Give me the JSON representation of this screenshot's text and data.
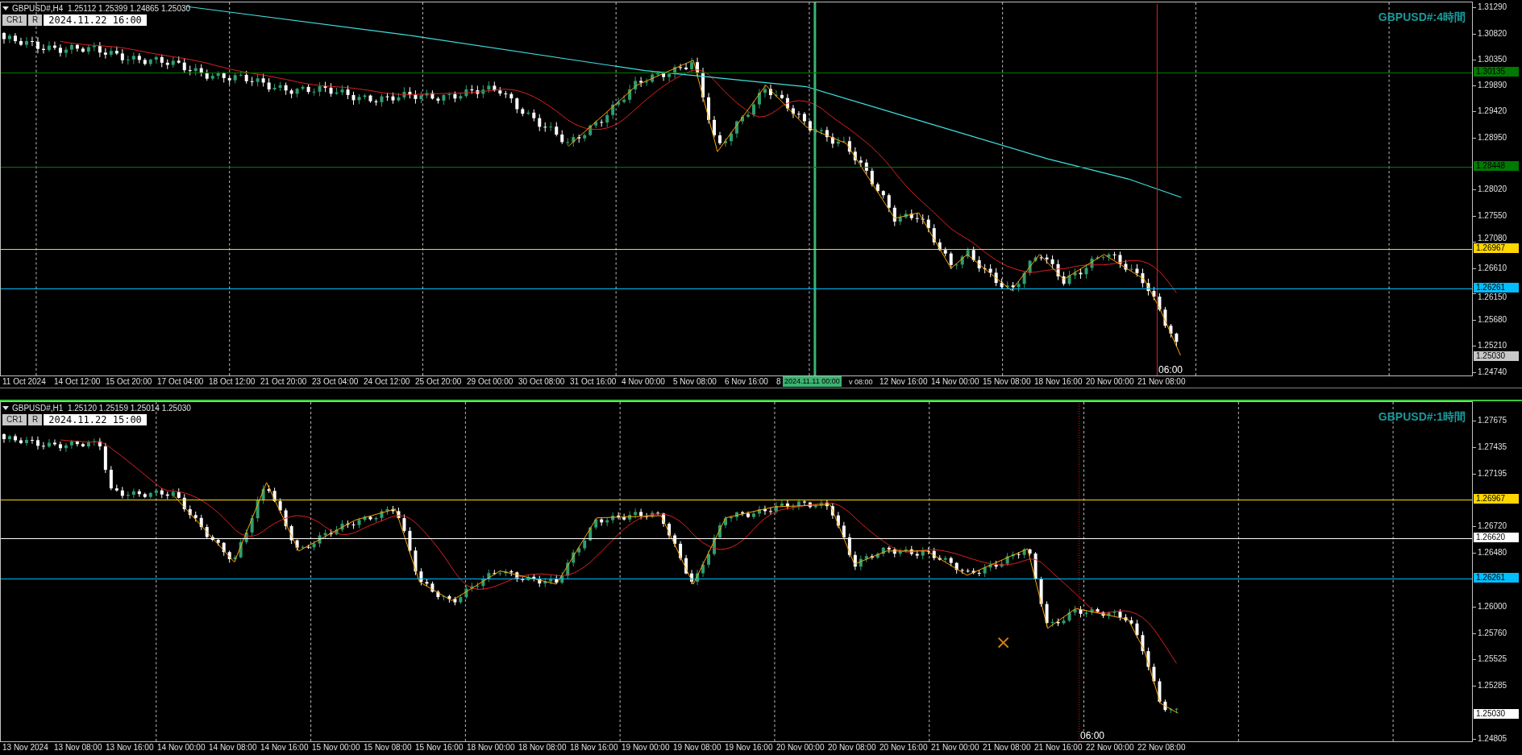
{
  "charts": [
    {
      "symbol_line": "GBPUSD#,H4  1.25112 1.25399 1.24865 1.25030",
      "buttons": [
        "CR1",
        "R"
      ],
      "date_field": "2024.11.22 16:00",
      "title": "GBPUSD#:4時間",
      "active": false,
      "price_axis": [
        "1.31290",
        "1.30820",
        "1.30350",
        "1.29890",
        "1.29420",
        "1.28950",
        "1.28020",
        "1.27550",
        "1.27080",
        "1.26610",
        "1.26150",
        "1.25680",
        "1.25210",
        "1.24740"
      ],
      "levels": [
        {
          "price": "1.30135",
          "color": "#007a00"
        },
        {
          "price": "1.28448",
          "color": "#007a00"
        },
        {
          "price": "1.26967",
          "color": "#ffd700"
        },
        {
          "price": "1.26261",
          "color": "#00bfff"
        }
      ],
      "current_price": {
        "price": "1.25030",
        "color": "#c8c8c8"
      },
      "vline_label": "06:00",
      "time_axis": [
        {
          "kind": "tick",
          "label": "11 Oct 2024"
        },
        {
          "kind": "tick",
          "label": "14 Oct 12:00"
        },
        {
          "kind": "tick",
          "label": "15 Oct 20:00"
        },
        {
          "kind": "tick",
          "label": "17 Oct 04:00"
        },
        {
          "kind": "tick",
          "label": "18 Oct 12:00"
        },
        {
          "kind": "tick",
          "label": "21 Oct 20:00"
        },
        {
          "kind": "tick",
          "label": "23 Oct 04:00"
        },
        {
          "kind": "tick",
          "label": "24 Oct 12:00"
        },
        {
          "kind": "tick",
          "label": "25 Oct 20:00"
        },
        {
          "kind": "tick",
          "label": "29 Oct 00:00"
        },
        {
          "kind": "tick",
          "label": "30 Oct 08:00"
        },
        {
          "kind": "tick",
          "label": "31 Oct 16:00"
        },
        {
          "kind": "tick",
          "label": "4 Nov 00:00"
        },
        {
          "kind": "tick",
          "label": "5 Nov 08:00"
        },
        {
          "kind": "tick",
          "label": "6 Nov 16:00"
        },
        {
          "kind": "tick",
          "label": "8"
        },
        {
          "kind": "crosshair",
          "label": "2024.11.11 00:00"
        },
        {
          "kind": "cut",
          "label": "v 08:00"
        },
        {
          "kind": "tick",
          "label": "12 Nov 16:00"
        },
        {
          "kind": "tick",
          "label": "14 Nov 00:00"
        },
        {
          "kind": "tick",
          "label": "15 Nov 08:00"
        },
        {
          "kind": "tick",
          "label": "18 Nov 16:00"
        },
        {
          "kind": "tick",
          "label": "20 Nov 00:00"
        },
        {
          "kind": "tick",
          "label": "21 Nov 08:00"
        }
      ]
    },
    {
      "symbol_line": "GBPUSD#,H1  1.25120 1.25159 1.25014 1.25030",
      "buttons": [
        "CR1",
        "R"
      ],
      "date_field": "2024.11.22 15:00",
      "title": "GBPUSD#:1時間",
      "active": true,
      "price_axis": [
        "1.27675",
        "1.27435",
        "1.27195",
        "1.26720",
        "1.26480",
        "1.26000",
        "1.25760",
        "1.25525",
        "1.25285",
        "1.24805"
      ],
      "levels": [
        {
          "price": "1.26967",
          "color": "#ffd700"
        },
        {
          "price": "1.26620",
          "color": "#ffffff"
        },
        {
          "price": "1.26261",
          "color": "#00bfff"
        }
      ],
      "current_price": {
        "price": "1.25030",
        "color": "#ffffff"
      },
      "vline_label": "06:00",
      "time_axis": [
        {
          "kind": "tick",
          "label": "13 Nov 2024"
        },
        {
          "kind": "tick",
          "label": "13 Nov 08:00"
        },
        {
          "kind": "tick",
          "label": "13 Nov 16:00"
        },
        {
          "kind": "tick",
          "label": "14 Nov 00:00"
        },
        {
          "kind": "tick",
          "label": "14 Nov 08:00"
        },
        {
          "kind": "tick",
          "label": "14 Nov 16:00"
        },
        {
          "kind": "tick",
          "label": "15 Nov 00:00"
        },
        {
          "kind": "tick",
          "label": "15 Nov 08:00"
        },
        {
          "kind": "tick",
          "label": "15 Nov 16:00"
        },
        {
          "kind": "tick",
          "label": "18 Nov 00:00"
        },
        {
          "kind": "tick",
          "label": "18 Nov 08:00"
        },
        {
          "kind": "tick",
          "label": "18 Nov 16:00"
        },
        {
          "kind": "tick",
          "label": "19 Nov 00:00"
        },
        {
          "kind": "tick",
          "label": "19 Nov 08:00"
        },
        {
          "kind": "tick",
          "label": "19 Nov 16:00"
        },
        {
          "kind": "tick",
          "label": "20 Nov 00:00"
        },
        {
          "kind": "tick",
          "label": "20 Nov 08:00"
        },
        {
          "kind": "tick",
          "label": "20 Nov 16:00"
        },
        {
          "kind": "tick",
          "label": "21 Nov 00:00"
        },
        {
          "kind": "tick",
          "label": "21 Nov 08:00"
        },
        {
          "kind": "tick",
          "label": "21 Nov 16:00"
        },
        {
          "kind": "tick",
          "label": "22 Nov 00:00"
        },
        {
          "kind": "tick",
          "label": "22 Nov 08:00"
        }
      ]
    }
  ]
}
